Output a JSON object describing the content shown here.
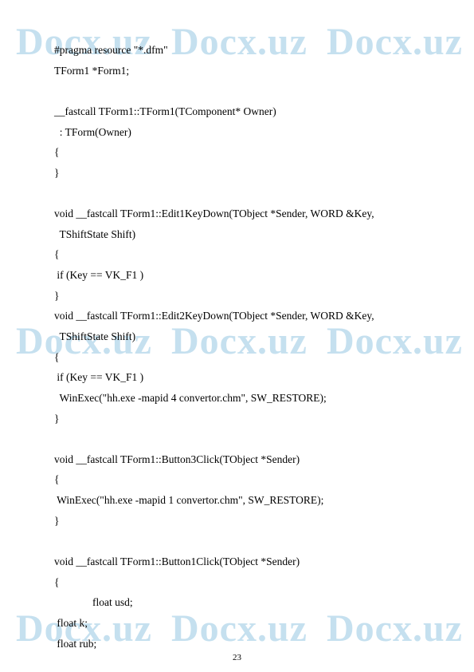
{
  "watermark": "Docx.uz",
  "page_number": "23",
  "code": {
    "l1": "#pragma resource \"*.dfm\"",
    "l2": "TForm1 *Form1;",
    "l3": "__fastcall TForm1::TForm1(TComponent* Owner)",
    "l4": "  : TForm(Owner)",
    "l5": "{",
    "l6": "}",
    "l7": "void __fastcall TForm1::Edit1KeyDown(TObject *Sender, WORD &Key,",
    "l8": "  TShiftState Shift)",
    "l9": "{",
    "l10": " if (Key == VK_F1 )",
    "l11": "}",
    "l12": "void __fastcall TForm1::Edit2KeyDown(TObject *Sender, WORD &Key,",
    "l13": "  TShiftState Shift)",
    "l14": "{",
    "l15": " if (Key == VK_F1 )",
    "l16": "  WinExec(\"hh.exe -mapid 4 convertor.chm\", SW_RESTORE);",
    "l17": "}",
    "l18": "void __fastcall TForm1::Button3Click(TObject *Sender)",
    "l19": "{",
    "l20": " WinExec(\"hh.exe -mapid 1 convertor.chm\", SW_RESTORE);",
    "l21": "}",
    "l22": "void __fastcall TForm1::Button1Click(TObject *Sender)",
    "l23": "{",
    "l24": "float usd;",
    "l25": " float k;",
    "l26": " float rub;"
  }
}
